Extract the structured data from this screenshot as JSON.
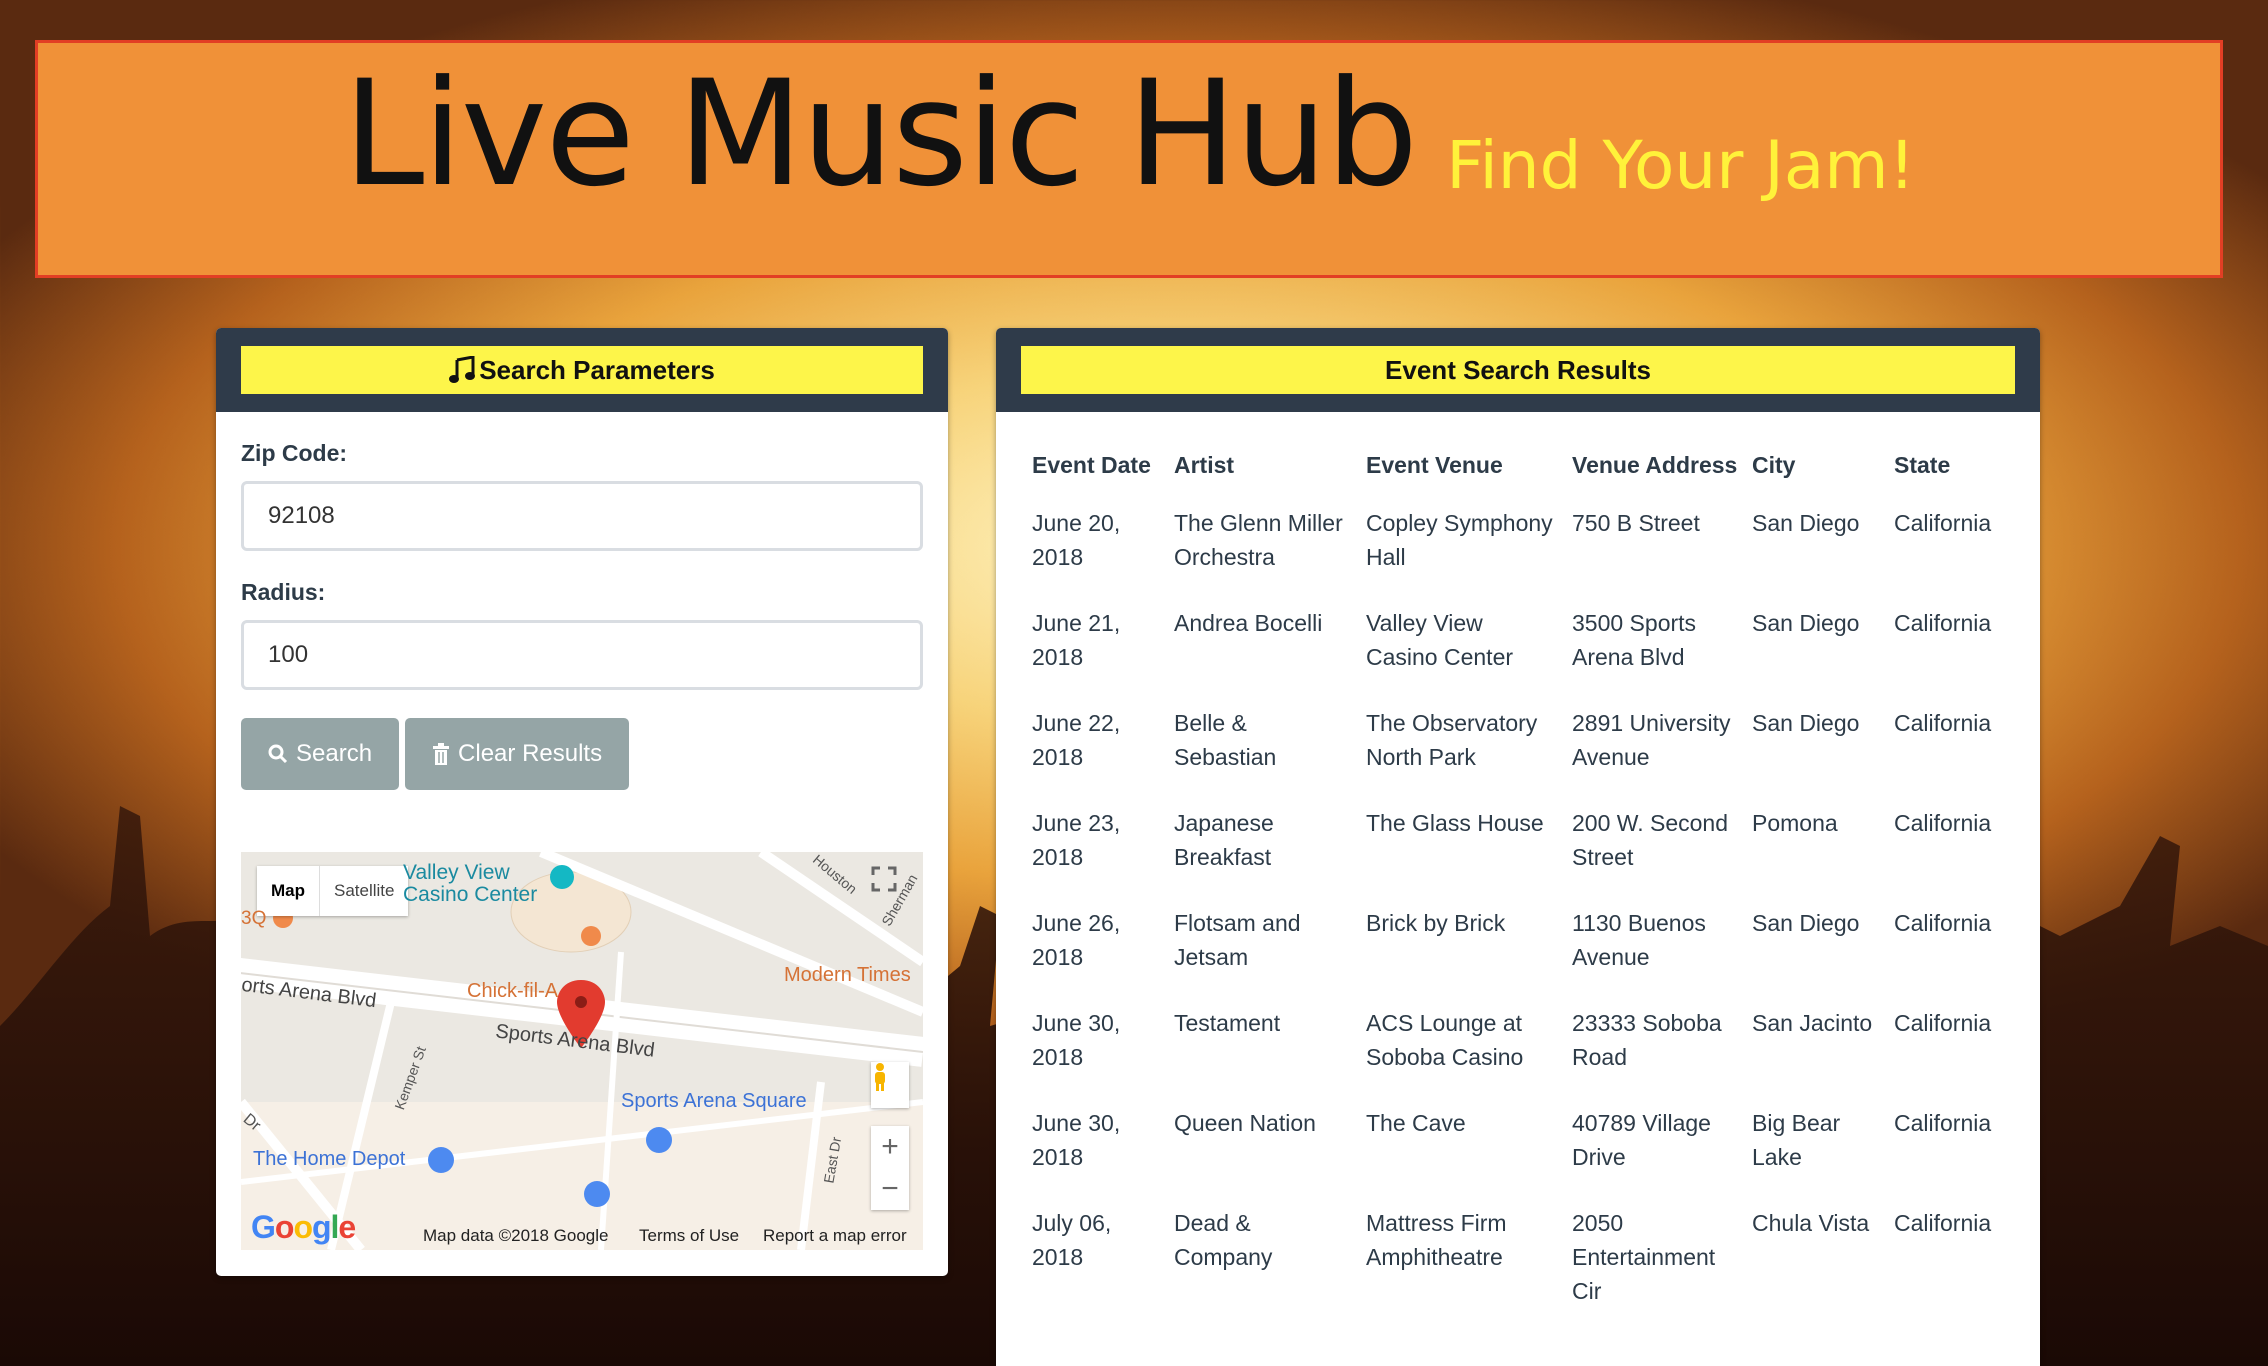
{
  "header": {
    "title": "Live Music Hub",
    "tagline": "Find Your Jam!"
  },
  "search_panel": {
    "heading": "Search Parameters",
    "heading_icon": "music-note-icon",
    "zip_label": "Zip Code:",
    "zip_value": "92108",
    "radius_label": "Radius:",
    "radius_value": "100",
    "search_button": "Search",
    "clear_button": "Clear Results"
  },
  "map": {
    "type_map": "Map",
    "type_satellite": "Satellite",
    "places": {
      "valley_view": "Valley View\nCasino Center",
      "chick": "Chick-fil-A",
      "modern_times": "Modern Times",
      "sports_arena_square": "Sports Arena Square",
      "home_depot": "The Home Depot",
      "bbq": "3Q"
    },
    "streets": {
      "sports_arena_blvd": "Sports Arena Blvd",
      "sports_arena_blvd_left": "orts Arena Blvd",
      "kemper": "Kemper St",
      "houston": "Houston",
      "sherman": "Sherman",
      "east_dr": "East Dr",
      "dr": "Dr"
    },
    "footer": {
      "data": "Map data ©2018 Google",
      "terms": "Terms of Use",
      "report": "Report a map error"
    },
    "logo": "Google"
  },
  "results_panel": {
    "heading": "Event Search Results",
    "columns": [
      "Event Date",
      "Artist",
      "Event Venue",
      "Venue Address",
      "City",
      "State"
    ],
    "rows": [
      [
        "June 20, 2018",
        "The Glenn Miller Orchestra",
        "Copley Symphony Hall",
        "750 B Street",
        "San Diego",
        "California"
      ],
      [
        "June 21, 2018",
        "Andrea Bocelli",
        "Valley View Casino Center",
        "3500 Sports Arena Blvd",
        "San Diego",
        "California"
      ],
      [
        "June 22, 2018",
        "Belle & Sebastian",
        "The Observatory North Park",
        "2891 University Avenue",
        "San Diego",
        "California"
      ],
      [
        "June 23, 2018",
        "Japanese Breakfast",
        "The Glass House",
        "200 W. Second Street",
        "Pomona",
        "California"
      ],
      [
        "June 26, 2018",
        "Flotsam and Jetsam",
        "Brick by Brick",
        "1130 Buenos Avenue",
        "San Diego",
        "California"
      ],
      [
        "June 30, 2018",
        "Testament",
        "ACS Lounge at Soboba Casino",
        "23333 Soboba Road",
        "San Jacinto",
        "California"
      ],
      [
        "June 30, 2018",
        "Queen Nation",
        "The Cave",
        "40789 Village Drive",
        "Big Bear Lake",
        "California"
      ],
      [
        "July 06, 2018",
        "Dead & Company",
        "Mattress Firm Amphitheatre",
        "2050 Entertainment Cir",
        "Chula Vista",
        "California"
      ]
    ]
  },
  "colors": {
    "banner_bg": "#f09138",
    "banner_border": "#e23e24",
    "tagline": "#fff23a",
    "panel_head": "#2f3b4a",
    "panel_heading_bar": "#fdf54a",
    "button_bg": "#95a5a6"
  }
}
